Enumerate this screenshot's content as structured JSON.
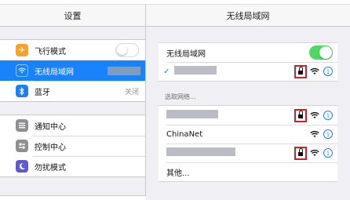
{
  "left_panel": {
    "title": "设置",
    "group1": [
      {
        "label": "飞行模式",
        "icon": "airplane-icon",
        "control": "toggle-off"
      },
      {
        "label": "无线局域网",
        "icon": "wifi-icon",
        "selected": true,
        "value_redacted": true
      },
      {
        "label": "蓝牙",
        "icon": "bluetooth-icon",
        "value": "关闭"
      }
    ],
    "group2": [
      {
        "label": "通知中心",
        "icon": "notification-center-icon"
      },
      {
        "label": "控制中心",
        "icon": "control-center-icon"
      },
      {
        "label": "勿扰模式",
        "icon": "moon-icon"
      }
    ]
  },
  "right_panel": {
    "title": "无线局域网",
    "wifi_toggle_label": "无线局域网",
    "wifi_enabled": true,
    "connected_network": {
      "name_redacted": true,
      "secured": true
    },
    "choose_network_title": "选取网络...",
    "networks": [
      {
        "name_redacted": true,
        "secured": true
      },
      {
        "name": "ChinaNet",
        "secured": false
      },
      {
        "name_redacted": true,
        "secured": true
      }
    ],
    "other_label": "其他..."
  },
  "colors": {
    "accent": "#1a82fb",
    "toggle_on": "#4cd964",
    "highlight_box": "#c0272d"
  }
}
